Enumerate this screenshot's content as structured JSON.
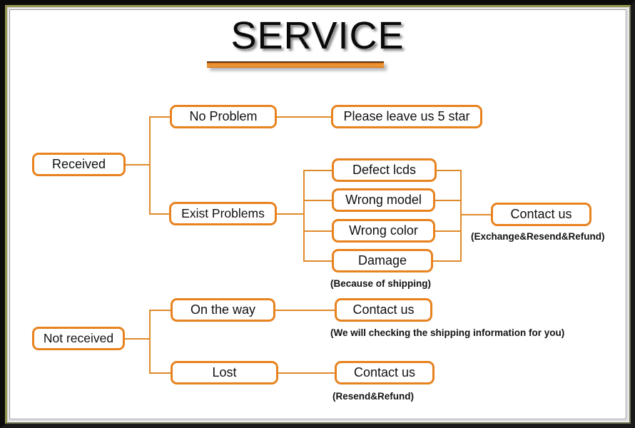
{
  "title": {
    "text": "SERVICE"
  },
  "nodes": {
    "received": "Received",
    "no_problem": "No Problem",
    "exist_problems": "Exist Problems",
    "please_leave": "Please leave us 5 star",
    "defect_lcds": "Defect lcds",
    "wrong_model": "Wrong model",
    "wrong_color": "Wrong color",
    "damage": "Damage",
    "contact_us_problems": "Contact us",
    "not_received": "Not received",
    "on_the_way": "On the way",
    "lost": "Lost",
    "contact_us_on_the_way": "Contact us",
    "contact_us_lost": "Contact us"
  },
  "notes": {
    "exchange_resend_refund": "(Exchange&Resend&Refund)",
    "because_of_shipping": "(Because of shipping)",
    "we_will_checking": "(We will checking the shipping information for you)",
    "resend_refund": "(Resend&Refund)"
  },
  "colors": {
    "node_border": "#e8821e",
    "connector": "#e08a2b",
    "underline": "#e8821e",
    "frame": "#0c0c0c",
    "text": "#101010"
  }
}
